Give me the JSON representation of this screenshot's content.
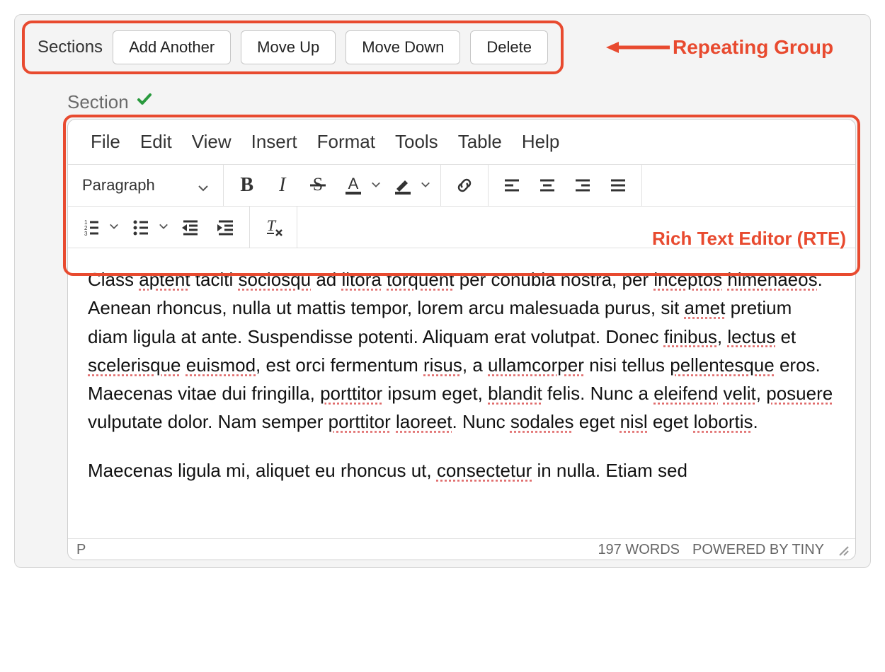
{
  "topbar": {
    "label": "Sections",
    "buttons": {
      "add": "Add Another",
      "up": "Move Up",
      "down": "Move Down",
      "delete": "Delete"
    }
  },
  "callouts": {
    "repeating_group": "Repeating Group",
    "rte": "Rich Text Editor (RTE)"
  },
  "section": {
    "label": "Section"
  },
  "menu": {
    "file": "File",
    "edit": "Edit",
    "view": "View",
    "insert": "Insert",
    "format": "Format",
    "tools": "Tools",
    "table": "Table",
    "help": "Help"
  },
  "toolbar": {
    "block_label": "Paragraph",
    "bold": "B",
    "italic": "I"
  },
  "content": {
    "p1_parts": [
      {
        "t": "Class "
      },
      {
        "t": "aptent",
        "sp": true
      },
      {
        "t": " taciti "
      },
      {
        "t": "sociosqu",
        "sp": true
      },
      {
        "t": " ad "
      },
      {
        "t": "litora",
        "sp": true
      },
      {
        "t": " "
      },
      {
        "t": "torquent",
        "sp": true
      },
      {
        "t": " per conubia nostra, per "
      },
      {
        "t": "inceptos",
        "sp": true
      },
      {
        "t": " "
      },
      {
        "t": "himenaeos",
        "sp": true
      },
      {
        "t": ". Aenean rhoncus, nulla ut mattis tempor, lorem arcu malesuada purus, sit "
      },
      {
        "t": "amet",
        "sp": true
      },
      {
        "t": " pretium diam ligula at ante. Suspendisse potenti. Aliquam erat volutpat. Donec "
      },
      {
        "t": "finibus",
        "sp": true
      },
      {
        "t": ", "
      },
      {
        "t": "lectus",
        "sp": true
      },
      {
        "t": " et "
      },
      {
        "t": "scelerisque",
        "sp": true
      },
      {
        "t": " "
      },
      {
        "t": "euismod",
        "sp": true
      },
      {
        "t": ", est orci fermentum "
      },
      {
        "t": "risus",
        "sp": true
      },
      {
        "t": ", a "
      },
      {
        "t": "ullamcorper",
        "sp": true
      },
      {
        "t": " nisi tellus "
      },
      {
        "t": "pellentesque",
        "sp": true
      },
      {
        "t": " eros. Maecenas vitae dui fringilla, "
      },
      {
        "t": "porttitor",
        "sp": true
      },
      {
        "t": " ipsum eget, "
      },
      {
        "t": "blandit",
        "sp": true
      },
      {
        "t": " felis. Nunc a "
      },
      {
        "t": "eleifend",
        "sp": true
      },
      {
        "t": " "
      },
      {
        "t": "velit",
        "sp": true
      },
      {
        "t": ", "
      },
      {
        "t": "posuere",
        "sp": true
      },
      {
        "t": " vulputate dolor. Nam semper "
      },
      {
        "t": "porttitor",
        "sp": true
      },
      {
        "t": " "
      },
      {
        "t": "laoreet",
        "sp": true
      },
      {
        "t": ". Nunc "
      },
      {
        "t": "sodales",
        "sp": true
      },
      {
        "t": " eget "
      },
      {
        "t": "nisl",
        "sp": true
      },
      {
        "t": " eget "
      },
      {
        "t": "lobortis",
        "sp": true
      },
      {
        "t": "."
      }
    ],
    "p2_parts": [
      {
        "t": "Maecenas ligula mi, aliquet eu rhoncus ut, "
      },
      {
        "t": "consectetur",
        "sp": true
      },
      {
        "t": " in nulla. Etiam sed"
      }
    ]
  },
  "statusbar": {
    "path": "P",
    "words": "197 WORDS",
    "powered": "POWERED BY TINY"
  }
}
